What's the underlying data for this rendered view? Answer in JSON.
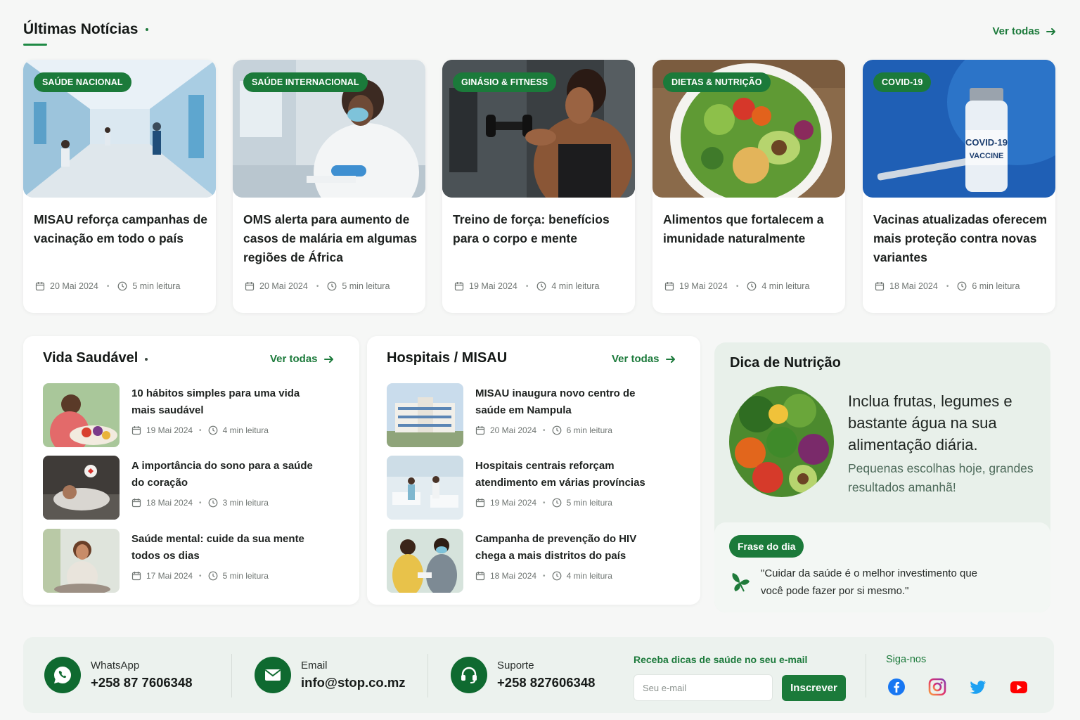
{
  "latest": {
    "title": "Últimas Notícias",
    "see_all": "Ver todas",
    "cards": [
      {
        "badge": "SAÚDE NACIONAL",
        "title": "MISAU reforça campanhas de vacinação em todo o país",
        "date": "20 Mai 2024",
        "read": "5 min leitura",
        "image": "hospital-corridor"
      },
      {
        "badge": "SAÚDE INTERNACIONAL",
        "title": "OMS alerta para aumento de casos de malária em algumas regiões de África",
        "date": "20 Mai 2024",
        "read": "5 min leitura",
        "image": "doctor-lab"
      },
      {
        "badge": "GINÁSIO & FITNESS",
        "title": "Treino de força: benefícios para o corpo e mente",
        "date": "19 Mai 2024",
        "read": "4 min leitura",
        "image": "woman-dumbbell"
      },
      {
        "badge": "DIETAS & NUTRIÇÃO",
        "title": "Alimentos que fortalecem a imunidade naturalmente",
        "date": "19 Mai 2024",
        "read": "4 min leitura",
        "image": "salad-bowl"
      },
      {
        "badge": "COVID-19",
        "title": "Vacinas atualizadas oferecem mais proteção contra novas variantes",
        "date": "18 Mai 2024",
        "read": "6 min leitura",
        "image": "vaccine-vial",
        "vial_text": [
          "COVID-19",
          "VACCINE"
        ]
      }
    ]
  },
  "healthy": {
    "title": "Vida Saudável",
    "see_all": "Ver todas",
    "items": [
      {
        "title": "10 hábitos simples para uma vida mais saudável",
        "date": "19 Mai 2024",
        "read": "4 min leitura"
      },
      {
        "title": "A importância do sono para a saúde do coração",
        "date": "18 Mai 2024",
        "read": "3 min leitura"
      },
      {
        "title": "Saúde mental: cuide da sua mente todos os dias",
        "date": "17 Mai 2024",
        "read": "5 min leitura"
      }
    ]
  },
  "hospitals": {
    "title": "Hospitais / MISAU",
    "see_all": "Ver todas",
    "items": [
      {
        "title": "MISAU inaugura novo centro de saúde em Nampula",
        "date": "20 Mai 2024",
        "read": "6 min leitura"
      },
      {
        "title": "Hospitais centrais reforçam atendimento em várias províncias",
        "date": "19 Mai 2024",
        "read": "5 min leitura"
      },
      {
        "title": "Campanha de prevenção do HIV chega a mais distritos do país",
        "date": "18 Mai 2024",
        "read": "4 min leitura"
      }
    ]
  },
  "tip": {
    "title": "Dica de Nutrição",
    "text": "Inclua frutas, legumes e bastante água na sua alimentação diária.",
    "subtext": "Pequenas escolhas hoje, grandes resultados amanhã!",
    "phrase_label": "Frase do dia",
    "quote": "\"Cuidar da saúde é o melhor investimento que você pode fazer por si mesmo.\""
  },
  "footer": {
    "whatsapp": {
      "label": "WhatsApp",
      "value": "+258 87 7606348"
    },
    "email": {
      "label": "Email",
      "value": "info@stop.co.mz"
    },
    "support": {
      "label": "Suporte",
      "value": "+258 827606348"
    },
    "newsletter": {
      "label": "Receba dicas de saúde no seu e-mail",
      "placeholder": "Seu e-mail",
      "button": "Inscrever"
    },
    "follow": "Siga-nos",
    "socials": [
      "facebook-icon",
      "instagram-icon",
      "twitter-icon",
      "youtube-icon"
    ]
  },
  "colors": {
    "brand": "#1b7a3a",
    "accent_text": "#1c7a3b",
    "tip_bg": "#e8f0ea",
    "footer_bg": "#ecf2ee"
  }
}
